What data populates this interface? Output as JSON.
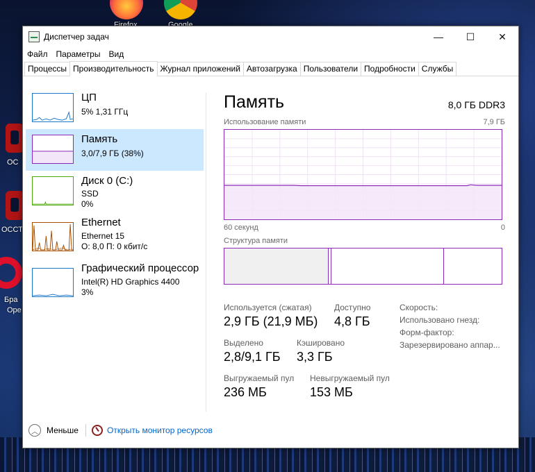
{
  "desktop": {
    "icons": [
      {
        "label": "Firefox"
      },
      {
        "label": "Google"
      }
    ],
    "left_labels": [
      "ОС",
      "ОССТ",
      "Бра",
      "Ope"
    ]
  },
  "window": {
    "title": "Диспетчер задач",
    "controls": {
      "minimize": "—",
      "maximize": "☐",
      "close": "✕"
    }
  },
  "menu": [
    "Файл",
    "Параметры",
    "Вид"
  ],
  "tabs": [
    "Процессы",
    "Производительность",
    "Журнал приложений",
    "Автозагрузка",
    "Пользователи",
    "Подробности",
    "Службы"
  ],
  "active_tab": "Производительность",
  "resources": [
    {
      "name": "ЦП",
      "line1": "5% 1,31 ГГц",
      "line2": "",
      "color": "#1a77c9"
    },
    {
      "name": "Память",
      "line1": "3,0/7,9 ГБ (38%)",
      "line2": "",
      "color": "#8b2ab8"
    },
    {
      "name": "Диск 0 (C:)",
      "line1": "SSD",
      "line2": "0%",
      "color": "#4da60c"
    },
    {
      "name": "Ethernet",
      "line1": "Ethernet 15",
      "line2": "О: 8,0 П: 0 кбит/с",
      "color": "#a74f01"
    },
    {
      "name": "Графический процессор",
      "line1": "Intel(R) HD Graphics 4400",
      "line2": "3%",
      "color": "#1a77c9"
    }
  ],
  "memory": {
    "title": "Память",
    "spec": "8,0 ГБ DDR3",
    "usage_label": "Использование памяти",
    "usage_max": "7,9 ГБ",
    "time_left": "60 секунд",
    "time_right": "0",
    "structure_label": "Структура памяти",
    "graph_level_fraction": 0.38,
    "stats": {
      "in_use_label": "Используется (сжатая)",
      "in_use_value": "2,9 ГБ (21,9 МБ)",
      "available_label": "Доступно",
      "available_value": "4,8 ГБ",
      "committed_label": "Выделено",
      "committed_value": "2,8/9,1 ГБ",
      "cached_label": "Кэшировано",
      "cached_value": "3,3 ГБ",
      "paged_label": "Выгружаемый пул",
      "paged_value": "236 МБ",
      "nonpaged_label": "Невыгружаемый пул",
      "nonpaged_value": "153 МБ"
    },
    "side": [
      "Скорость:",
      "Использовано гнезд:",
      "Форм-фактор:",
      "Зарезервировано аппар..."
    ]
  },
  "footer": {
    "less": "Меньше",
    "open_monitor": "Открыть монитор ресурсов"
  }
}
